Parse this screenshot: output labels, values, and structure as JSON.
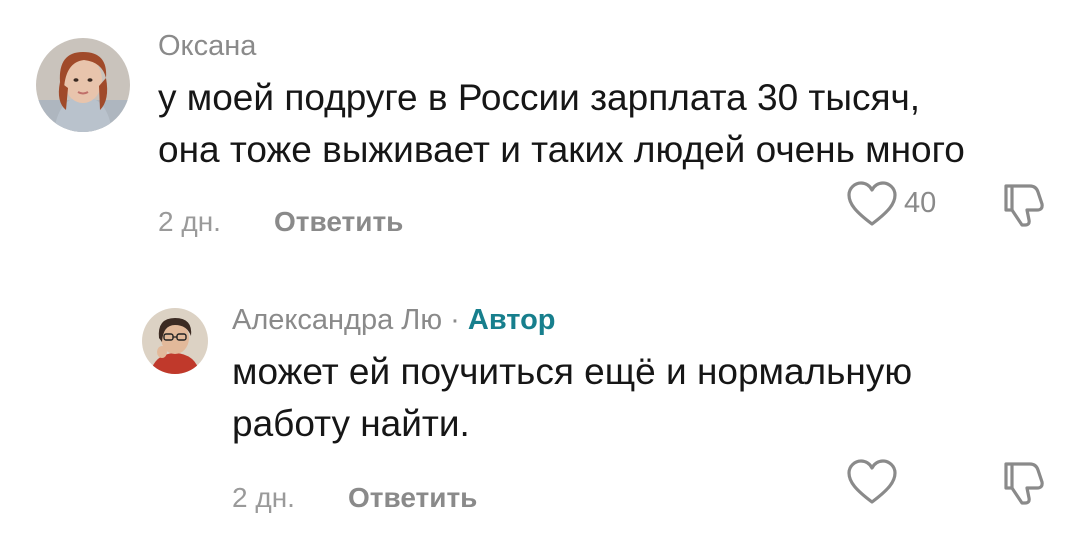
{
  "comments": [
    {
      "username": "Оксана",
      "text_line1": "у моей подруге в России зарплата 30 тысяч,",
      "text_line2": "она тоже выживает и таких людей очень много",
      "time": "2 дн.",
      "reply_label": "Ответить",
      "likes": "40",
      "like_icon": "heart-outline-icon",
      "dislike_icon": "thumbs-down-outline-icon"
    },
    {
      "username": "Александра Лю",
      "separator": "·",
      "author_badge": "Автор",
      "text_line1": "может ей поучиться ещё и нормальную",
      "text_line2": "работу найти.",
      "time": "2 дн.",
      "reply_label": "Ответить",
      "like_icon": "heart-outline-icon",
      "dislike_icon": "thumbs-down-outline-icon"
    }
  ],
  "colors": {
    "author_accent": "#177f8d",
    "text": "#161616",
    "muted": "#8a8a8a"
  }
}
